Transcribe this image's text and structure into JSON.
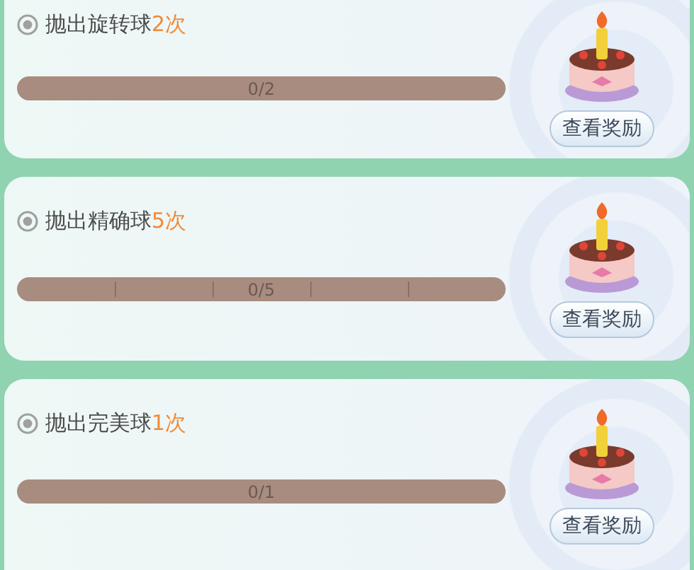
{
  "tasks": [
    {
      "title": "抛出旋转球",
      "count": "2次",
      "kind": "plain",
      "progress": "0/2",
      "button": "查看奖励"
    },
    {
      "title": "抛出精确球",
      "count": "5次",
      "kind": "segmented",
      "progress": "0/5",
      "button": "查看奖励"
    },
    {
      "title": "抛出完美球",
      "count": "1次",
      "kind": "plain",
      "progress": "0/1",
      "button": "查看奖励"
    }
  ]
}
